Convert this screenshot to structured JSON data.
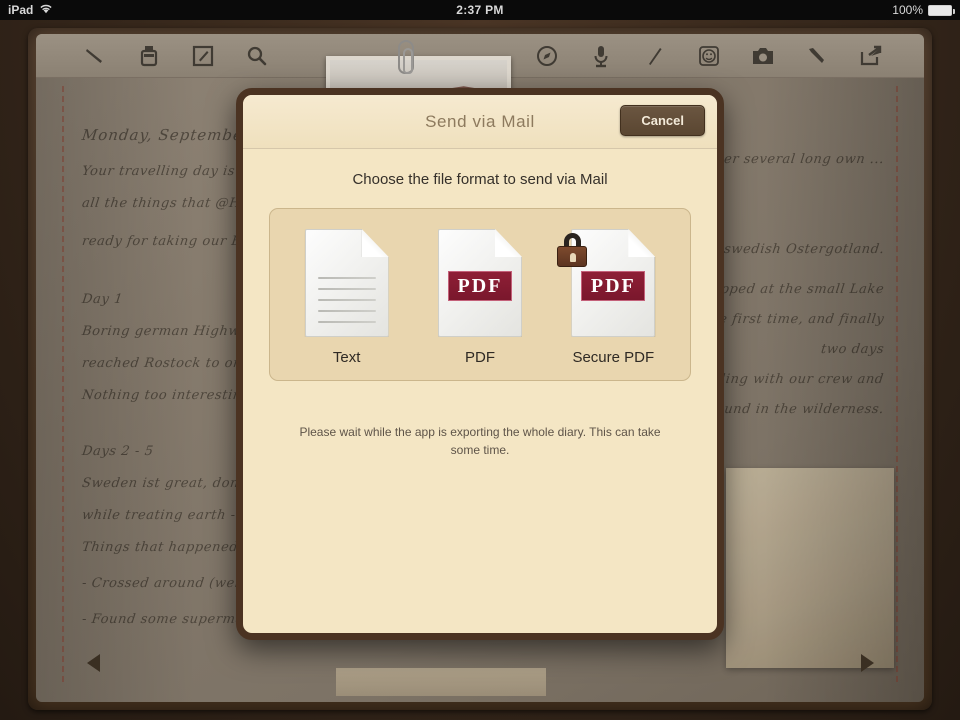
{
  "statusbar": {
    "device": "iPad",
    "wifi_icon": "wifi-icon",
    "time": "2:37 PM",
    "battery_percent": "100%",
    "battery_icon": "battery-icon"
  },
  "toolbar": {
    "left_items": [
      {
        "name": "pen-icon",
        "label": "Pen"
      },
      {
        "name": "ink-bottle-icon",
        "label": "Ink"
      },
      {
        "name": "compose-icon",
        "label": "Compose"
      },
      {
        "name": "search-icon",
        "label": "Search"
      }
    ],
    "right_items": [
      {
        "name": "compass-icon",
        "label": "Location"
      },
      {
        "name": "microphone-icon",
        "label": "Audio"
      },
      {
        "name": "pencil-icon",
        "label": "Draw"
      },
      {
        "name": "smiley-icon",
        "label": "Mood"
      },
      {
        "name": "camera-icon",
        "label": "Photo"
      },
      {
        "name": "wrench-icon",
        "label": "Settings"
      },
      {
        "name": "share-icon",
        "label": "Share"
      }
    ]
  },
  "page": {
    "entry_title": "Monday, September 20,",
    "left_lines": [
      "Your travelling day is here .  Af",
      "all the things that @Home  & W",
      "ready for taking our Bully to ",
      "Day 1",
      "Boring german Highways, not fa",
      "reached Rostock to order our fer",
      "Nothing too interesting happene",
      "Days 2 - 5",
      "Sweden ist great, don't know ho",
      "while treating earth - Beautyfull",
      "Things that happened the last 5",
      "- Crossed around (well nothing",
      "- Found some supermarket camp"
    ],
    "right_lines": [
      "After several long own ...",
      "in middleswedish Ostergotland.",
      "and stopped at the small Lake",
      "for the first time, and finally",
      "two days",
      "travelling with our crew and",
      "campground in the wilderness."
    ],
    "nav_prev": "previous-page",
    "nav_next": "next-page"
  },
  "dialog": {
    "title": "Send via Mail",
    "cancel_label": "Cancel",
    "prompt": "Choose the file format to send via Mail",
    "formats": [
      {
        "id": "text",
        "label": "Text",
        "badge": "",
        "icon": "text-document-icon",
        "secure": false
      },
      {
        "id": "pdf",
        "label": "PDF",
        "badge": "PDF",
        "icon": "pdf-document-icon",
        "secure": false
      },
      {
        "id": "secure-pdf",
        "label": "Secure PDF",
        "badge": "PDF",
        "icon": "secure-pdf-document-icon",
        "secure": true
      }
    ],
    "wait_message": "Please wait while the app is exporting the whole diary. This can take some time."
  },
  "colors": {
    "dialog_bg": "#f4e6c4",
    "dialog_border": "#4b3322",
    "panel_bg": "#e9d6af",
    "pdf_badge": "#8e1f36",
    "cancel_button": "#5a4631",
    "leather": "#46321f",
    "page": "#857a6c"
  }
}
